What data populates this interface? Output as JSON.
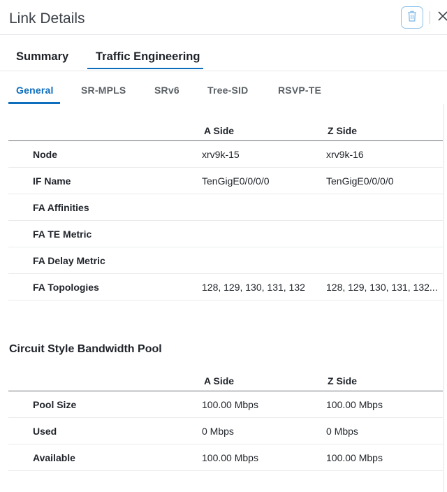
{
  "panel": {
    "title": "Link Details"
  },
  "icons": {
    "trash": "trash-icon",
    "close": "close-icon"
  },
  "colors": {
    "accent": "#0d6ebd",
    "trash_border": "#8cc1ea"
  },
  "tabs_primary": [
    {
      "label": "Summary",
      "active": false
    },
    {
      "label": "Traffic Engineering",
      "active": true
    }
  ],
  "tabs_secondary": [
    {
      "label": "General",
      "active": true
    },
    {
      "label": "SR-MPLS",
      "active": false
    },
    {
      "label": "SRv6",
      "active": false
    },
    {
      "label": "Tree-SID",
      "active": false
    },
    {
      "label": "RSVP-TE",
      "active": false
    }
  ],
  "general_table": {
    "headers": {
      "a": "A Side",
      "z": "Z Side"
    },
    "rows": [
      {
        "label": "Node",
        "a": "xrv9k-15",
        "z": "xrv9k-16"
      },
      {
        "label": "IF Name",
        "a": "TenGigE0/0/0/0",
        "z": "TenGigE0/0/0/0"
      },
      {
        "label": "FA Affinities",
        "a": "",
        "z": ""
      },
      {
        "label": "FA TE Metric",
        "a": "",
        "z": ""
      },
      {
        "label": "FA Delay Metric",
        "a": "",
        "z": ""
      },
      {
        "label": "FA Topologies",
        "a": "128, 129, 130, 131, 132",
        "z": "128, 129, 130, 131, 132..."
      }
    ]
  },
  "bandwidth_pool": {
    "title": "Circuit Style Bandwidth Pool",
    "headers": {
      "a": "A Side",
      "z": "Z Side"
    },
    "rows": [
      {
        "label": "Pool Size",
        "a": "100.00 Mbps",
        "z": "100.00 Mbps"
      },
      {
        "label": "Used",
        "a": "0 Mbps",
        "z": "0 Mbps"
      },
      {
        "label": "Available",
        "a": "100.00 Mbps",
        "z": "100.00 Mbps"
      }
    ]
  }
}
